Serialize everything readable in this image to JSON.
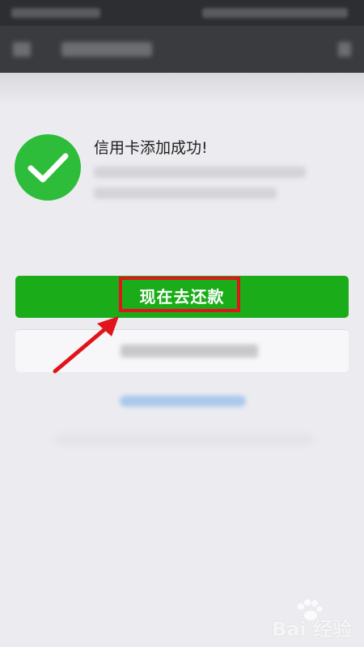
{
  "success": {
    "title": "信用卡添加成功!"
  },
  "actions": {
    "primary_label": "现在去还款"
  },
  "colors": {
    "primary_green": "#1aad19",
    "success_icon": "#2ebd3b",
    "highlight_red": "#e0141a",
    "background": "#ececf0",
    "header": "#3a3b3e"
  },
  "icons": {
    "success": "checkmark-circle-icon",
    "back": "back-arrow-icon",
    "annotation": "red-arrow-icon",
    "watermark_paw": "paw-print-icon"
  },
  "watermark": {
    "text": "Bai 经验"
  }
}
